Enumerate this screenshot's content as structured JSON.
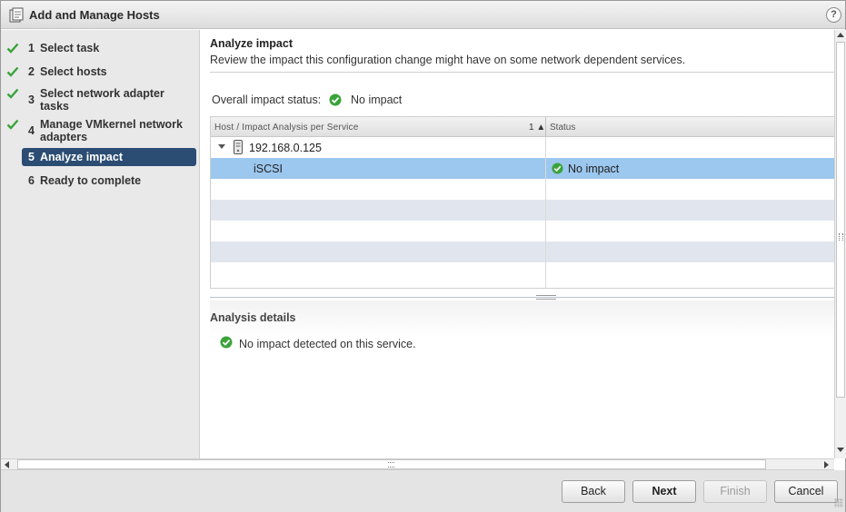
{
  "window": {
    "title": "Add and Manage Hosts",
    "help_label": "?"
  },
  "steps": [
    {
      "num": "1",
      "label": "Select task",
      "done": true
    },
    {
      "num": "2",
      "label": "Select hosts",
      "done": true
    },
    {
      "num": "3",
      "label": "Select network adapter tasks",
      "done": true
    },
    {
      "num": "4",
      "label": "Manage VMkernel network adapters",
      "done": true
    },
    {
      "num": "5",
      "label": "Analyze impact",
      "active": true
    },
    {
      "num": "6",
      "label": "Ready to complete",
      "done": false
    }
  ],
  "main": {
    "title": "Analyze impact",
    "subtitle": "Review the impact this configuration change might have on some network dependent services.",
    "overall_label": "Overall impact status:",
    "overall_value": "No impact"
  },
  "grid": {
    "col1_header": "Host / Impact Analysis per Service",
    "sort_indicator": "1 ▲",
    "col2_header": "Status",
    "host": "192.168.0.125",
    "service": "iSCSI",
    "service_status": "No impact"
  },
  "details": {
    "title": "Analysis details",
    "message": "No impact detected on this service."
  },
  "buttons": {
    "back": "Back",
    "next": "Next",
    "finish": "Finish",
    "cancel": "Cancel"
  },
  "colors": {
    "active_step_bg": "#2c4d73",
    "selected_row_bg": "#9cc7ee",
    "success_green": "#3aa33a"
  }
}
